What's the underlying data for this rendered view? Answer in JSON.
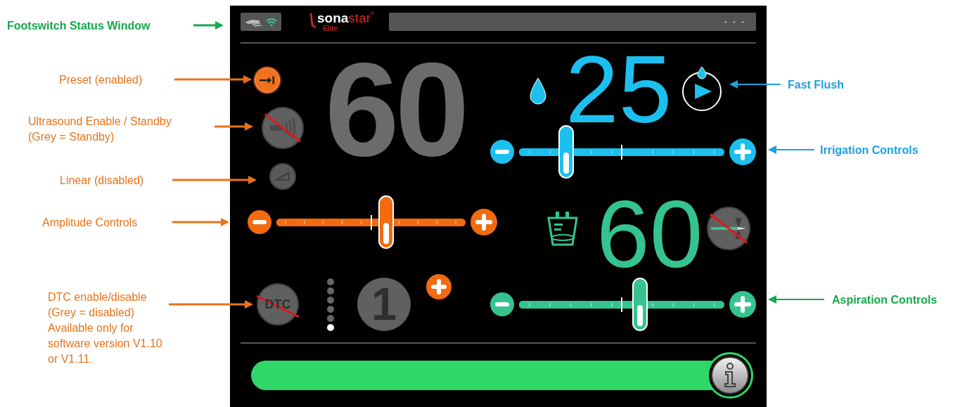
{
  "annotations": [
    {
      "text": "Footswitch Status Window",
      "color": "#17a84b"
    },
    {
      "text": "Preset (enabled)",
      "color": "#e8731a"
    },
    {
      "text": "Ultrasound Enable / Standby\n(Grey = Standby)",
      "color": "#e8731a"
    },
    {
      "text": "Linear (disabled)",
      "color": "#e8731a"
    },
    {
      "text": "Amplitude Controls",
      "color": "#e8731a"
    },
    {
      "text": "DTC enable/disable\n(Grey =  disabled)\nAvailable only for\nsoftware version V1.10\nor V1.11.",
      "color": "#e8731a"
    },
    {
      "text": "Fast Flush",
      "color": "#1ea0dc"
    },
    {
      "text": "Irrigation Controls",
      "color": "#1ea0dc"
    },
    {
      "text": "Aspiration Controls",
      "color": "#17a84b"
    }
  ],
  "header": {
    "footswitch": {
      "connected": true
    },
    "logo": {
      "bold": "sona",
      "light": "star",
      "mark": "®",
      "sub": "Elite"
    },
    "status_bar": {
      "text": "• • •"
    }
  },
  "ultrasound": {
    "preset_enabled": true,
    "enabled": false,
    "linear_enabled": false,
    "amplitude": "60",
    "level": 0.58
  },
  "dtc": {
    "label": "DTC",
    "enabled": false,
    "value": "1",
    "steps": [
      {
        "selected": false
      },
      {
        "selected": false
      },
      {
        "selected": false
      },
      {
        "selected": false
      },
      {
        "selected": false
      },
      {
        "selected": true
      }
    ]
  },
  "irrigation": {
    "value": "25",
    "level": 0.23
  },
  "aspiration": {
    "value": "60",
    "level": 0.59,
    "vent_enabled": false
  }
}
